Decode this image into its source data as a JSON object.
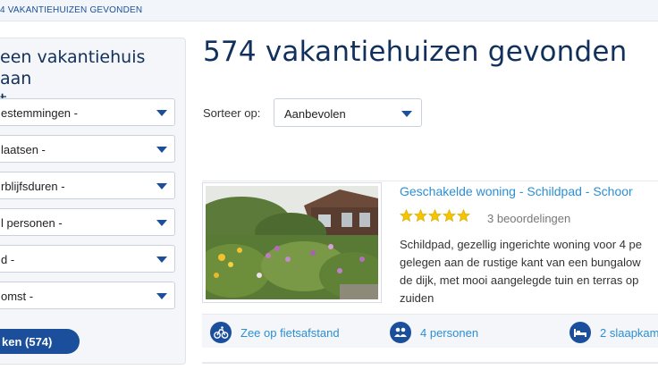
{
  "breadcrumb": "4 VAKANTIEHUIZEN GEVONDEN",
  "sidebar": {
    "title_line1": "een vakantiehuis aan",
    "title_line2": "t",
    "selects": [
      {
        "label": "estemmingen -"
      },
      {
        "label": "laatsen -"
      },
      {
        "label": "rblijfsduren -"
      },
      {
        "label": "l personen -"
      },
      {
        "label": "d -"
      },
      {
        "label": "omst -"
      }
    ],
    "search_button": "ken (574)"
  },
  "results": {
    "heading": "574 vakantiehuizen gevonden",
    "sort_label": "Sorteer op:",
    "sort_value": "Aanbevolen"
  },
  "listing": {
    "title": "Geschakelde woning - Schildpad - Schoor",
    "rating": 5,
    "reviews": "3 beoordelingen",
    "description": [
      "Schildpad, gezellig ingerichte woning voor 4 pe",
      "gelegen aan de rustige kant van een bungalow",
      "de dijk, met mooi aangelegde tuin en terras op",
      "zuiden"
    ],
    "features": [
      {
        "icon": "bicycle-icon",
        "label": "Zee op fietsafstand"
      },
      {
        "icon": "people-icon",
        "label": "4 personen"
      },
      {
        "icon": "bed-icon",
        "label": "2 slaapkam"
      }
    ]
  },
  "colors": {
    "brand": "#1b4f9c",
    "link": "#2b8fd4",
    "star": "#f3c400",
    "heading": "#12305c"
  }
}
